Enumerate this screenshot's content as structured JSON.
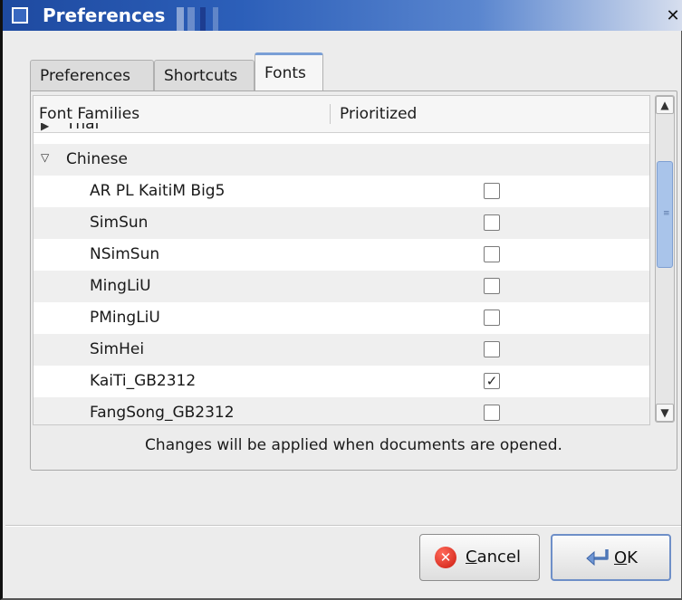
{
  "window": {
    "title": "Preferences"
  },
  "tabs": [
    {
      "label": "Preferences"
    },
    {
      "label": "Shortcuts"
    },
    {
      "label": "Fonts",
      "active": true
    }
  ],
  "table": {
    "columns": [
      "Font Families",
      "Prioritized"
    ],
    "partial_row": "Thai",
    "group": {
      "label": "Chinese",
      "expanded": true
    },
    "rows": [
      {
        "name": "AR PL KaitiM Big5",
        "checked": false
      },
      {
        "name": "SimSun",
        "checked": false
      },
      {
        "name": "NSimSun",
        "checked": false
      },
      {
        "name": "MingLiU",
        "checked": false
      },
      {
        "name": "PMingLiU",
        "checked": false
      },
      {
        "name": "SimHei",
        "checked": false
      },
      {
        "name": "KaiTi_GB2312",
        "checked": true
      },
      {
        "name": "FangSong_GB2312",
        "checked": false
      }
    ]
  },
  "status": {
    "text": "Changes will be applied when documents are opened."
  },
  "buttons": {
    "cancel": {
      "prefix": "",
      "mnemonic": "C",
      "rest": "ancel"
    },
    "ok": {
      "prefix": "",
      "mnemonic": "O",
      "rest": "K"
    }
  },
  "icons": {
    "app": "window-icon",
    "close": "close-icon",
    "expand": "triangle-down-icon",
    "check": "checkmark-icon",
    "cancel": "cancel-icon",
    "ok": "enter-arrow-icon"
  },
  "colors": {
    "titlebar": "#2c5fb9",
    "window_bg": "#ececec",
    "scroll_thumb": "#a9c4ea",
    "cancel_icon": "#d0231a"
  }
}
